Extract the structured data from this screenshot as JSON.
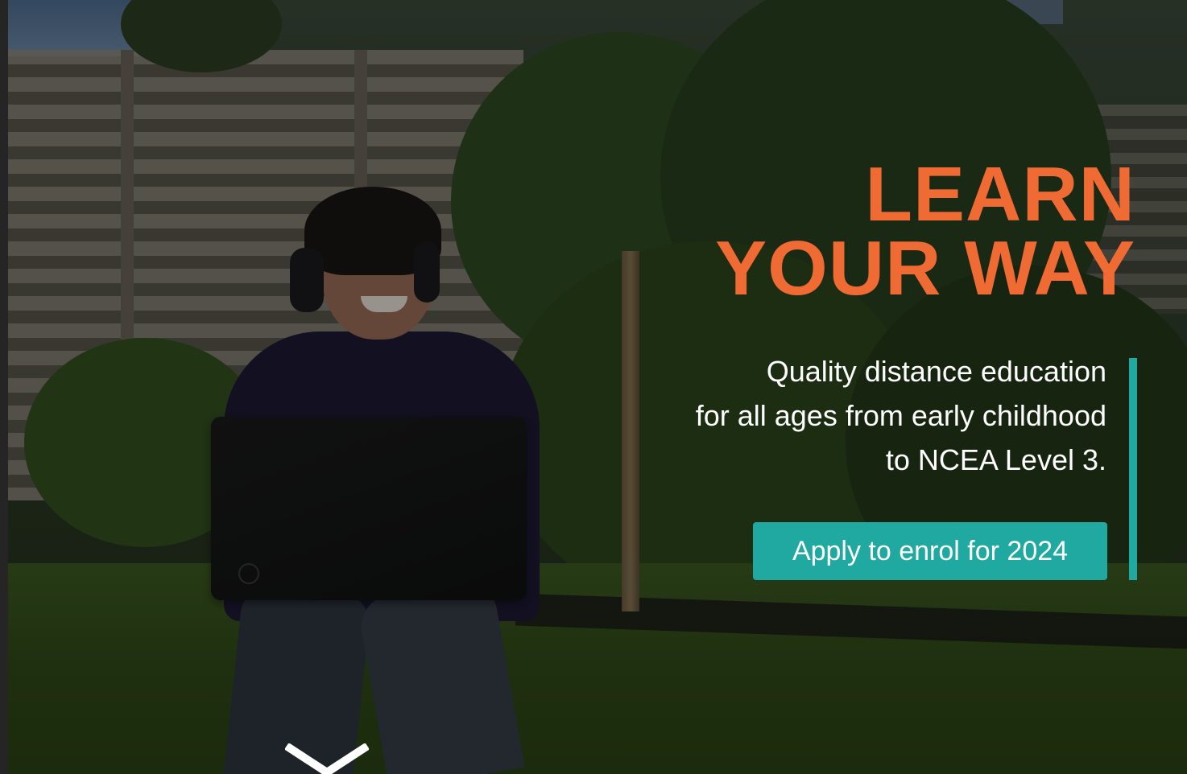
{
  "hero": {
    "headline_line1": "LEARN",
    "headline_line2": "YOUR WAY",
    "subtext_line1": "Quality distance education",
    "subtext_line2": "for all ages from early childhood",
    "subtext_line3": "to NCEA Level 3.",
    "cta_label": "Apply to enrol for 2024",
    "scroll_icon": "chevron-down-icon"
  },
  "colors": {
    "headline": "#f06a33",
    "accent": "#1fa9a0",
    "text": "#ffffff"
  }
}
